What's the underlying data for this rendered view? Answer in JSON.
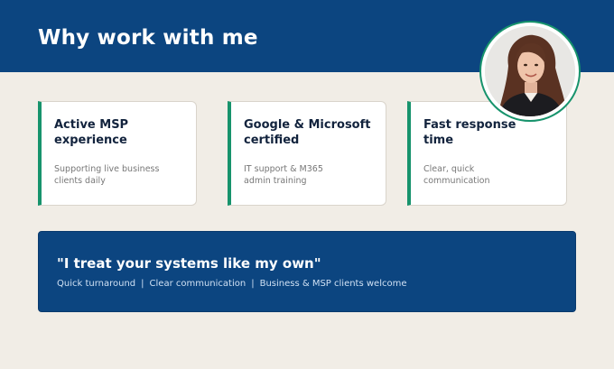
{
  "header": {
    "title": "Why work with me"
  },
  "cards": [
    {
      "title": "Active MSP\nexperience",
      "description": "Supporting live business\nclients daily"
    },
    {
      "title": "Google & Microsoft\ncertified",
      "description": "IT support & M365\nadmin training"
    },
    {
      "title": "Fast response\ntime",
      "description": "Clear, quick\ncommunication"
    }
  ],
  "quote": {
    "text": "\"I treat your systems like my own\"",
    "tags": [
      "Quick turnaround",
      "Clear communication",
      "Business & MSP clients welcome"
    ],
    "separator": "|"
  },
  "colors": {
    "header_bg": "#0c4580",
    "page_bg": "#f1ede6",
    "accent": "#17936c",
    "card_title": "#12233d",
    "card_desc": "#777777"
  },
  "icons": {
    "avatar": "profile-photo-avatar"
  }
}
